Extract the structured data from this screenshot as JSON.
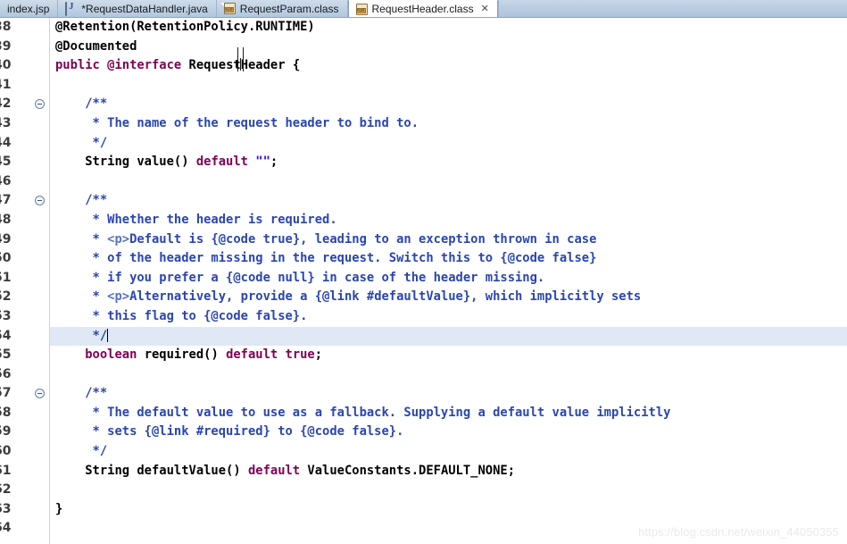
{
  "window": {
    "application": "Eclipse IDE",
    "active_file": "RequestHeader.class"
  },
  "tabbar": {
    "tabs": [
      {
        "label": "index.jsp",
        "icon": "none",
        "active": false,
        "dirty": false,
        "closable": false
      },
      {
        "label": "*RequestDataHandler.java",
        "icon": "java-file-icon",
        "active": false,
        "dirty": true,
        "closable": false
      },
      {
        "label": "RequestParam.class",
        "icon": "class-file-icon",
        "active": false,
        "dirty": false,
        "closable": false
      },
      {
        "label": "RequestHeader.class",
        "icon": "class-file-icon",
        "active": true,
        "dirty": false,
        "closable": true
      }
    ],
    "close_glyph": "✕",
    "class_icon_digits": "010",
    "java_icon_letter": "J"
  },
  "editor": {
    "first_line_number": 38,
    "highlighted_line": 54,
    "caret_line": 54,
    "fold_markers": [
      42,
      47,
      57
    ],
    "lines": [
      {
        "n": 38,
        "tokens": [
          {
            "t": "@Retention(RetentionPolicy.RUNTIME)",
            "c": "plain"
          }
        ]
      },
      {
        "n": 39,
        "tokens": [
          {
            "t": "@Documented",
            "c": "plain"
          }
        ]
      },
      {
        "n": 40,
        "tokens": [
          {
            "t": "public ",
            "c": "kw"
          },
          {
            "t": "@interface ",
            "c": "kw"
          },
          {
            "t": "Request",
            "c": "plain"
          },
          {
            "t": "CURSOR",
            "c": "ibeam"
          },
          {
            "t": "Header {",
            "c": "plain"
          }
        ]
      },
      {
        "n": 41,
        "tokens": [
          {
            "t": "",
            "c": "plain"
          }
        ]
      },
      {
        "n": 42,
        "tokens": [
          {
            "t": "    /**",
            "c": "doc"
          }
        ]
      },
      {
        "n": 43,
        "tokens": [
          {
            "t": "     * The name of the request header to bind to.",
            "c": "doc"
          }
        ]
      },
      {
        "n": 44,
        "tokens": [
          {
            "t": "     */",
            "c": "doc"
          }
        ]
      },
      {
        "n": 45,
        "tokens": [
          {
            "t": "    String value() ",
            "c": "plain"
          },
          {
            "t": "default ",
            "c": "kw"
          },
          {
            "t": "\"\"",
            "c": "str"
          },
          {
            "t": ";",
            "c": "plain"
          }
        ]
      },
      {
        "n": 46,
        "tokens": [
          {
            "t": "",
            "c": "plain"
          }
        ]
      },
      {
        "n": 47,
        "tokens": [
          {
            "t": "    /**",
            "c": "doc"
          }
        ]
      },
      {
        "n": 48,
        "tokens": [
          {
            "t": "     * Whether the header is required.",
            "c": "doc"
          }
        ]
      },
      {
        "n": 49,
        "tokens": [
          {
            "t": "     * ",
            "c": "doc"
          },
          {
            "t": "<p>",
            "c": "html"
          },
          {
            "t": "Default is {@code true}, leading to an exception thrown in case",
            "c": "doc"
          }
        ]
      },
      {
        "n": 50,
        "tokens": [
          {
            "t": "     * of the header missing in the request. Switch this to {@code false}",
            "c": "doc"
          }
        ]
      },
      {
        "n": 51,
        "tokens": [
          {
            "t": "     * if you prefer a {@code null} in case of the header missing.",
            "c": "doc"
          }
        ]
      },
      {
        "n": 52,
        "tokens": [
          {
            "t": "     * ",
            "c": "doc"
          },
          {
            "t": "<p>",
            "c": "html"
          },
          {
            "t": "Alternatively, provide a {@link #defaultValue}, which implicitly sets",
            "c": "doc"
          }
        ]
      },
      {
        "n": 53,
        "tokens": [
          {
            "t": "     * this flag to {@code false}.",
            "c": "doc"
          }
        ]
      },
      {
        "n": 54,
        "tokens": [
          {
            "t": "     */",
            "c": "doc"
          },
          {
            "t": "CARET",
            "c": "caret"
          }
        ]
      },
      {
        "n": 55,
        "tokens": [
          {
            "t": "    boolean ",
            "c": "kw"
          },
          {
            "t": "required() ",
            "c": "plain"
          },
          {
            "t": "default ",
            "c": "kw"
          },
          {
            "t": "true",
            "c": "kw"
          },
          {
            "t": ";",
            "c": "plain"
          }
        ]
      },
      {
        "n": 56,
        "tokens": [
          {
            "t": "",
            "c": "plain"
          }
        ]
      },
      {
        "n": 57,
        "tokens": [
          {
            "t": "    /**",
            "c": "doc"
          }
        ]
      },
      {
        "n": 58,
        "tokens": [
          {
            "t": "     * The default value to use as a fallback. Supplying a default value implicitly",
            "c": "doc"
          }
        ]
      },
      {
        "n": 59,
        "tokens": [
          {
            "t": "     * sets {@link #required} to {@code false}.",
            "c": "doc"
          }
        ]
      },
      {
        "n": 60,
        "tokens": [
          {
            "t": "     */",
            "c": "doc"
          }
        ]
      },
      {
        "n": 61,
        "tokens": [
          {
            "t": "    String defaultValue() ",
            "c": "plain"
          },
          {
            "t": "default ",
            "c": "kw"
          },
          {
            "t": "ValueConstants.DEFAULT_NONE;",
            "c": "plain"
          }
        ]
      },
      {
        "n": 62,
        "tokens": [
          {
            "t": "",
            "c": "plain"
          }
        ]
      },
      {
        "n": 63,
        "tokens": [
          {
            "t": "}",
            "c": "plain"
          }
        ]
      },
      {
        "n": 64,
        "tokens": [
          {
            "t": "",
            "c": "plain"
          }
        ]
      }
    ]
  },
  "watermark": {
    "text": "https://blog.csdn.net/weixin_44050355"
  },
  "colors": {
    "keyword": "#7f0055",
    "javadoc": "#2a45b2",
    "javadoc_html_tag": "#5a72bd",
    "string": "#2a00ff",
    "plain": "#000000",
    "line_highlight": "#dfe8f4",
    "tabbar_bg": "#b9cce1",
    "active_tab_bg": "#ffffff",
    "watermark": "#eaeaea"
  }
}
